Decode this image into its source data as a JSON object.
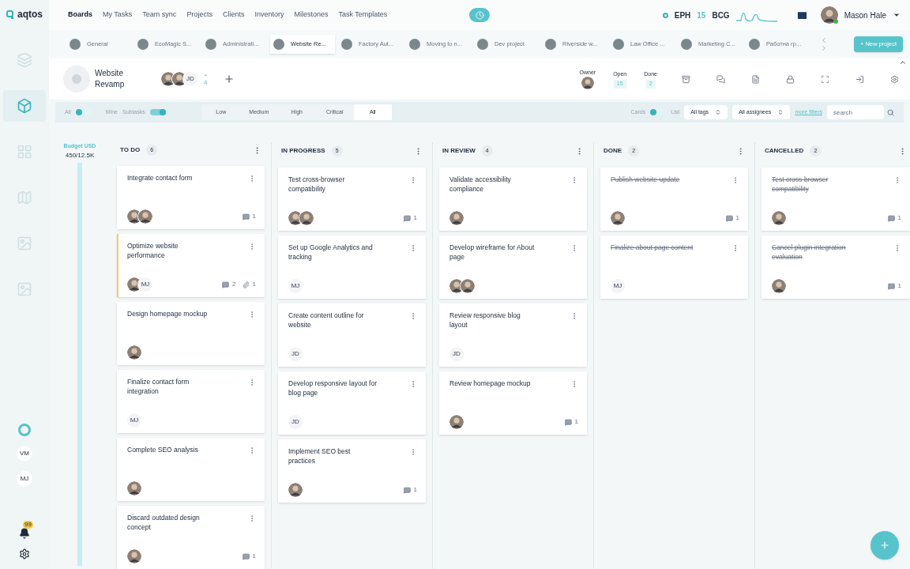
{
  "brand": "aqtos",
  "nav": [
    {
      "label": "Boards",
      "selected": true
    },
    {
      "label": "My Tasks",
      "selected": false
    },
    {
      "label": "Team sync",
      "selected": false
    },
    {
      "label": "Projects",
      "selected": false
    },
    {
      "label": "Clients",
      "selected": false
    },
    {
      "label": "Inventory",
      "selected": false
    },
    {
      "label": "Milestones",
      "selected": false
    },
    {
      "label": "Task Templates",
      "selected": false
    }
  ],
  "stats_bar": {
    "left": "EPH",
    "value": "15",
    "right": "BCG"
  },
  "user": {
    "name": "Mason Hale",
    "online": true
  },
  "project_tabs": [
    {
      "label": "General",
      "selected": false
    },
    {
      "label": "EcoMagic S...",
      "selected": false
    },
    {
      "label": "Administrati...",
      "selected": false
    },
    {
      "label": "Website Re...",
      "selected": true
    },
    {
      "label": "Factory Aut...",
      "selected": false
    },
    {
      "label": "Moving to n...",
      "selected": false
    },
    {
      "label": "Dev project",
      "selected": false
    },
    {
      "label": "Riverside w...",
      "selected": false
    },
    {
      "label": "Law Office ...",
      "selected": false
    },
    {
      "label": "Marketing C...",
      "selected": false
    },
    {
      "label": "Работна гр...",
      "selected": false
    }
  ],
  "new_project": "+ New project",
  "project": {
    "name": "Website Revamp",
    "members": [
      {
        "kind": "photo"
      },
      {
        "kind": "photo"
      },
      {
        "kind": "initials",
        "text": "JD"
      }
    ],
    "more_sign": "+",
    "more_count": "4"
  },
  "summary": {
    "owner_label": "Owner",
    "open_label": "Open",
    "open_value": "15",
    "done_label": "Done",
    "done_value": "2"
  },
  "filters": {
    "all_label": "All",
    "all_on": false,
    "mine_label": "Mine",
    "subtasks_label": "Subtasks",
    "subtasks_on": true,
    "priorities": [
      {
        "label": "Low",
        "selected": false
      },
      {
        "label": "Medium",
        "selected": false
      },
      {
        "label": "High",
        "selected": false
      },
      {
        "label": "Critical",
        "selected": false
      },
      {
        "label": "All",
        "selected": true
      }
    ],
    "cards_label": "Cards",
    "list_label": "List",
    "list_on": false,
    "tags": "All tags",
    "assignees": "All assignees",
    "more_filters": "more filters",
    "search_placeholder": "search"
  },
  "budget": {
    "label": "Budget USD",
    "value": "450/12.5K"
  },
  "columns": [
    {
      "title": "TO DO",
      "count": "6",
      "cards": [
        {
          "title": "Integrate contact form",
          "done": false,
          "flagged": false,
          "people": [
            {
              "kind": "photo"
            },
            {
              "kind": "photo"
            }
          ],
          "comments": "1"
        },
        {
          "title": "Optimize website performance",
          "done": false,
          "flagged": true,
          "people": [
            {
              "kind": "photo"
            },
            {
              "kind": "initials",
              "text": "MJ"
            }
          ],
          "comments": "2",
          "attachments": "1"
        },
        {
          "title": "Design homepage mockup",
          "done": false,
          "flagged": false,
          "people": [
            {
              "kind": "photo"
            }
          ]
        },
        {
          "title": "Finalize contact form integration",
          "done": false,
          "flagged": false,
          "people": [
            {
              "kind": "initials",
              "text": "MJ"
            }
          ]
        },
        {
          "title": "Complete SEO analysis",
          "done": false,
          "flagged": false,
          "people": [
            {
              "kind": "photo"
            }
          ]
        },
        {
          "title": "Discard outdated design concept",
          "done": false,
          "flagged": false,
          "people": [
            {
              "kind": "photo"
            }
          ],
          "comments": "1"
        }
      ]
    },
    {
      "title": "IN PROGRESS",
      "count": "5",
      "cards": [
        {
          "title": "Test cross-browser compatibility",
          "done": false,
          "flagged": false,
          "people": [
            {
              "kind": "photo"
            },
            {
              "kind": "photo"
            }
          ],
          "comments": "1"
        },
        {
          "title": "Set up Google Analytics and tracking",
          "done": false,
          "flagged": false,
          "people": [
            {
              "kind": "initials",
              "text": "MJ"
            }
          ]
        },
        {
          "title": "Create content outline for website",
          "done": false,
          "flagged": false,
          "people": [
            {
              "kind": "initials",
              "text": "JD"
            }
          ]
        },
        {
          "title": "Develop responsive layout for blog page",
          "done": false,
          "flagged": false,
          "people": [
            {
              "kind": "initials",
              "text": "JD"
            }
          ]
        },
        {
          "title": "Implement SEO best practices",
          "done": false,
          "flagged": false,
          "people": [
            {
              "kind": "photo"
            }
          ],
          "comments": "1"
        }
      ]
    },
    {
      "title": "IN REVIEW",
      "count": "4",
      "cards": [
        {
          "title": "Validate accessibility compliance",
          "done": false,
          "flagged": false,
          "people": [
            {
              "kind": "photo"
            }
          ]
        },
        {
          "title": "Develop wireframe for About page",
          "done": false,
          "flagged": false,
          "people": [
            {
              "kind": "photo"
            },
            {
              "kind": "photo"
            }
          ]
        },
        {
          "title": "Review responsive blog layout",
          "done": false,
          "flagged": false,
          "people": [
            {
              "kind": "initials",
              "text": "JD"
            }
          ]
        },
        {
          "title": "Review homepage mockup",
          "done": false,
          "flagged": false,
          "people": [
            {
              "kind": "photo"
            }
          ],
          "comments": "1"
        }
      ]
    },
    {
      "title": "DONE",
      "count": "2",
      "cards": [
        {
          "title": "Publish website update",
          "done": true,
          "flagged": false,
          "people": [
            {
              "kind": "photo"
            }
          ],
          "comments": "1"
        },
        {
          "title": "Finalize about page content",
          "done": true,
          "flagged": false,
          "people": [
            {
              "kind": "initials",
              "text": "MJ"
            }
          ]
        }
      ]
    },
    {
      "title": "CANCELLED",
      "count": "2",
      "cards": [
        {
          "title": "Test cross-browser compatibility",
          "done": true,
          "flagged": false,
          "people": [
            {
              "kind": "photo"
            }
          ],
          "comments": "1"
        },
        {
          "title": "Cancel plugin integration evaluation",
          "done": true,
          "flagged": false,
          "people": [
            {
              "kind": "photo"
            }
          ],
          "comments": "1"
        }
      ]
    }
  ],
  "sidebar_users": [
    "VM",
    "MJ"
  ],
  "notifications": "99"
}
